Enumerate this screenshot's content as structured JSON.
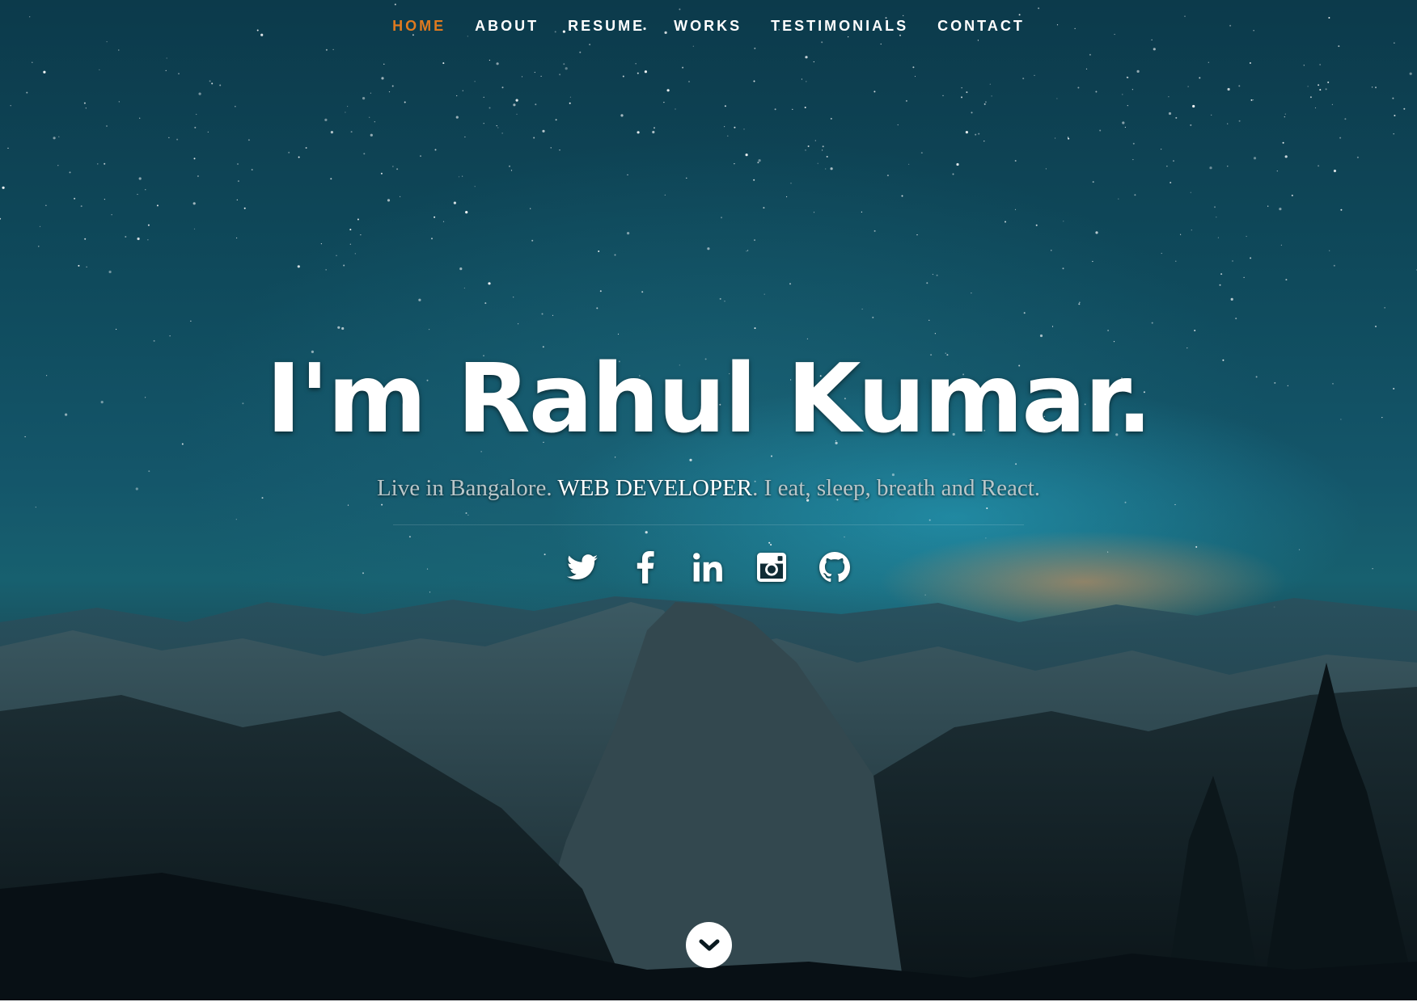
{
  "nav": {
    "items": [
      {
        "label": "HOME",
        "active": true
      },
      {
        "label": "ABOUT",
        "active": false
      },
      {
        "label": "RESUME",
        "active": false
      },
      {
        "label": "WORKS",
        "active": false
      },
      {
        "label": "TESTIMONIALS",
        "active": false
      },
      {
        "label": "CONTACT",
        "active": false
      }
    ],
    "active_color": "#e07a1f"
  },
  "banner": {
    "headline": "I'm Rahul Kumar.",
    "tagline_before": "Live in Bangalore. ",
    "tagline_role": "WEB DEVELOPER",
    "tagline_after": ". I eat, sleep, breath and React."
  },
  "social": [
    {
      "icon": "twitter-icon"
    },
    {
      "icon": "facebook-icon"
    },
    {
      "icon": "linkedin-icon"
    },
    {
      "icon": "instagram-icon"
    },
    {
      "icon": "github-icon"
    }
  ],
  "scroll_down": {
    "icon": "chevron-down-icon"
  }
}
